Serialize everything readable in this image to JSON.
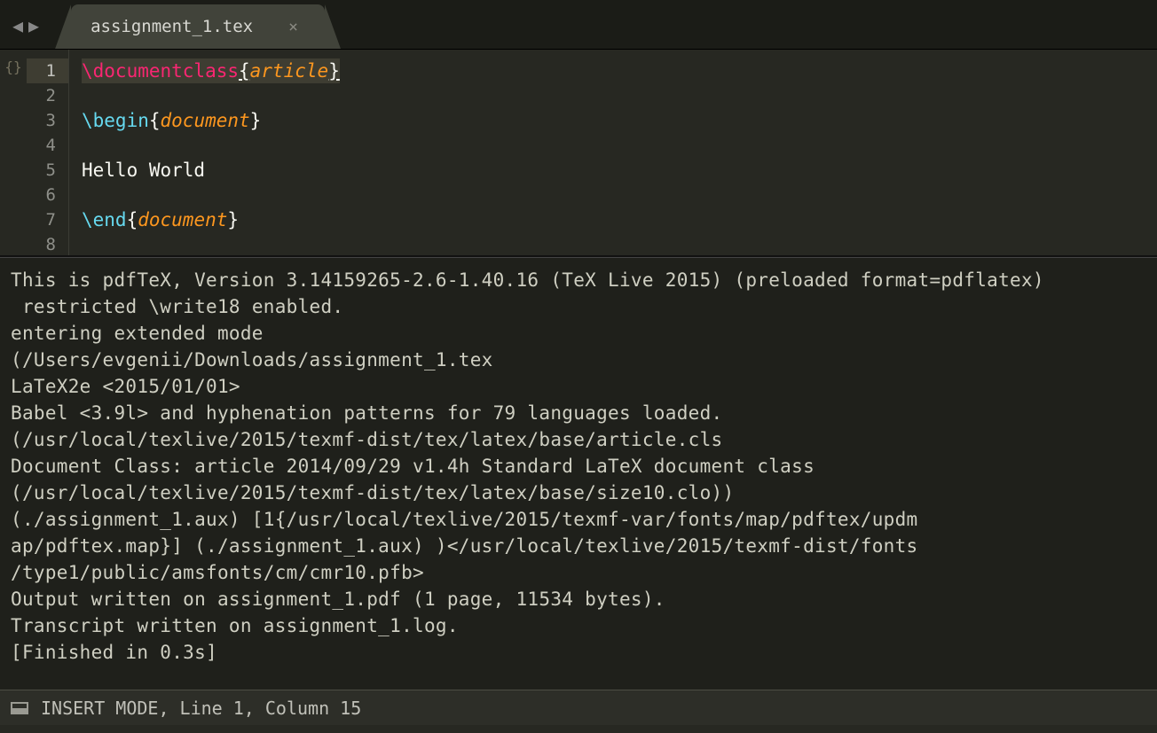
{
  "tab": {
    "filename": "assignment_1.tex",
    "close_glyph": "×"
  },
  "nav": {
    "back_glyph": "◀",
    "forward_glyph": "▶"
  },
  "fold_icon": "{}",
  "gutter": {
    "lines": [
      "1",
      "2",
      "3",
      "4",
      "5",
      "6",
      "7",
      "8"
    ],
    "active_index": 0
  },
  "code": {
    "l1": {
      "cmd": "\\documentclass",
      "lbr": "{",
      "arg": "article",
      "rbr": "}"
    },
    "l3": {
      "cmd": "\\begin",
      "lbr": "{",
      "arg": "document",
      "rbr": "}"
    },
    "l5": {
      "text": "Hello World"
    },
    "l7": {
      "cmd": "\\end",
      "lbr": "{",
      "arg": "document",
      "rbr": "}"
    }
  },
  "console_text": "This is pdfTeX, Version 3.14159265-2.6-1.40.16 (TeX Live 2015) (preloaded format=pdflatex)\n restricted \\write18 enabled.\nentering extended mode\n(/Users/evgenii/Downloads/assignment_1.tex\nLaTeX2e <2015/01/01>\nBabel <3.9l> and hyphenation patterns for 79 languages loaded.\n(/usr/local/texlive/2015/texmf-dist/tex/latex/base/article.cls\nDocument Class: article 2014/09/29 v1.4h Standard LaTeX document class\n(/usr/local/texlive/2015/texmf-dist/tex/latex/base/size10.clo))\n(./assignment_1.aux) [1{/usr/local/texlive/2015/texmf-var/fonts/map/pdftex/updm\nap/pdftex.map}] (./assignment_1.aux) )</usr/local/texlive/2015/texmf-dist/fonts\n/type1/public/amsfonts/cm/cmr10.pfb>\nOutput written on assignment_1.pdf (1 page, 11534 bytes).\nTranscript written on assignment_1.log.\n[Finished in 0.3s]",
  "status": {
    "text": "INSERT MODE, Line 1, Column 15"
  }
}
